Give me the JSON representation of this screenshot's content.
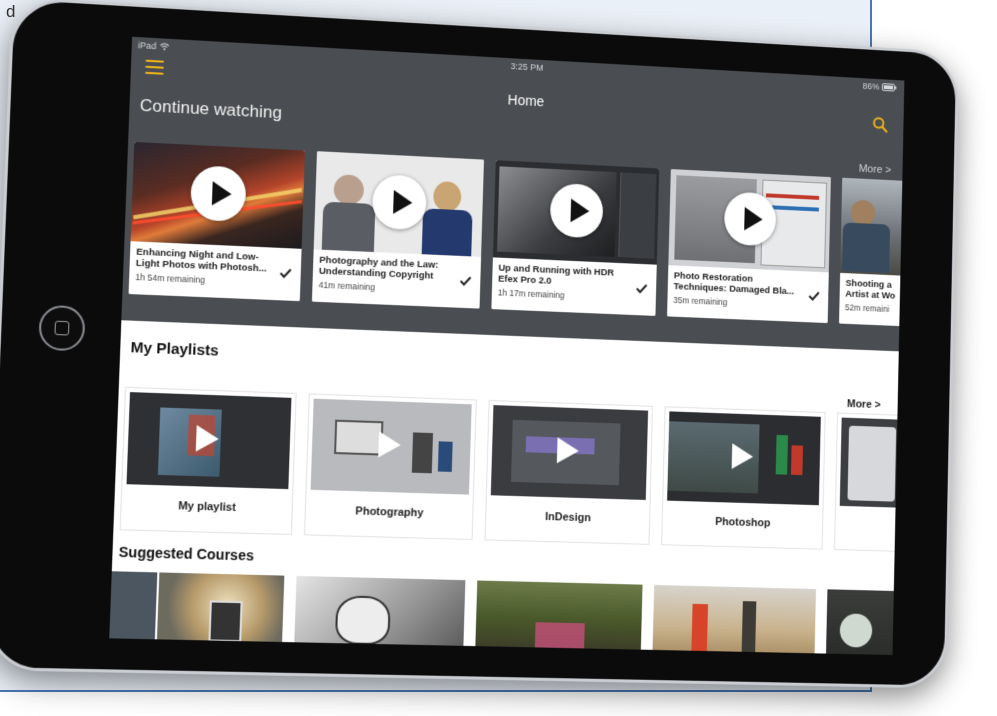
{
  "page_snippet": [
    "d",
    ",",
    "."
  ],
  "status_bar": {
    "device": "iPad",
    "time": "3:25 PM",
    "battery": "86%"
  },
  "header": {
    "title": "Home"
  },
  "continue_watching": {
    "title": "Continue watching",
    "more_label": "More >",
    "items": [
      {
        "title": "Enhancing Night and Low-Light Photos with Photosh...",
        "remaining": "1h 54m remaining"
      },
      {
        "title": "Photography and the Law: Understanding Copyright",
        "remaining": "41m remaining"
      },
      {
        "title": "Up and Running with HDR Efex Pro 2.0",
        "remaining": "1h 17m remaining"
      },
      {
        "title": "Photo Restoration Techniques: Damaged Bla...",
        "remaining": "35m remaining"
      },
      {
        "title": "Shooting a Artist at Wo",
        "remaining": "52m remaini"
      }
    ]
  },
  "playlists": {
    "title": "My Playlists",
    "more_label": "More >",
    "items": [
      {
        "label": "My playlist"
      },
      {
        "label": "Photography"
      },
      {
        "label": "InDesign"
      },
      {
        "label": "Photoshop"
      },
      {
        "label": ""
      }
    ]
  },
  "suggested": {
    "title": "Suggested Courses"
  },
  "colors": {
    "accent": "#f0b41b",
    "dark_bg": "#4a4d51",
    "frame": "#0b0b0c",
    "page_border": "#4a78b5"
  }
}
